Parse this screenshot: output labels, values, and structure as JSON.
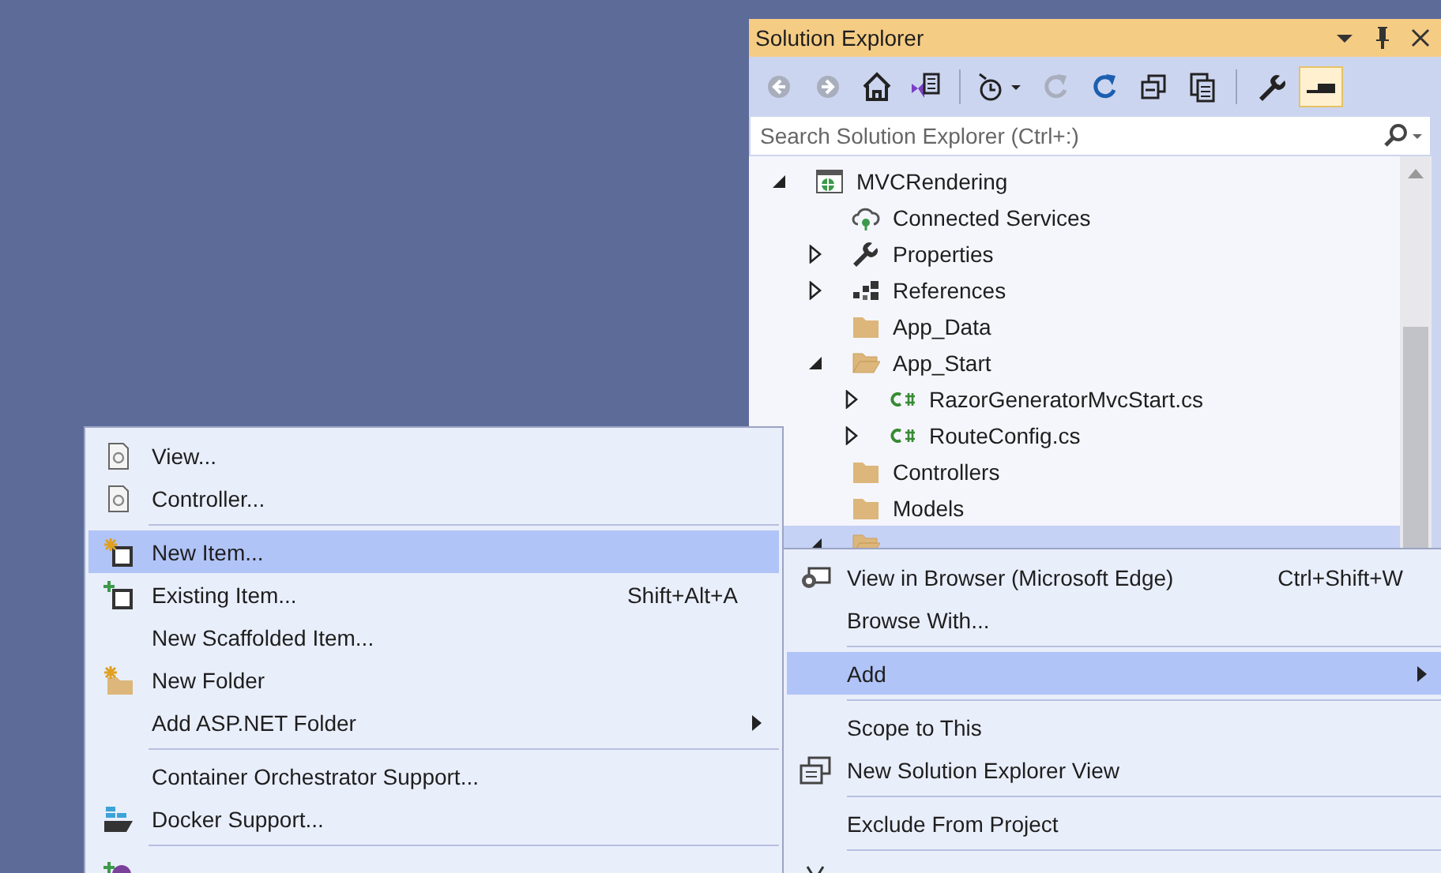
{
  "solution_explorer": {
    "title": "Solution Explorer",
    "toolbar": [
      {
        "kind": "back",
        "disabled": true,
        "on": false
      },
      {
        "kind": "forward",
        "disabled": true,
        "on": false
      },
      {
        "kind": "home",
        "disabled": false,
        "on": false
      },
      {
        "kind": "switch-views",
        "disabled": false,
        "on": false
      },
      {
        "kind": "separator"
      },
      {
        "kind": "pending-changes",
        "disabled": false,
        "on": false
      },
      {
        "kind": "sync",
        "disabled": true,
        "on": false
      },
      {
        "kind": "refresh",
        "disabled": false,
        "on": false
      },
      {
        "kind": "collapse-all",
        "disabled": false,
        "on": false
      },
      {
        "kind": "show-all-files",
        "disabled": false,
        "on": false
      },
      {
        "kind": "separator"
      },
      {
        "kind": "properties",
        "disabled": false,
        "on": false
      },
      {
        "kind": "preview",
        "disabled": false,
        "on": true
      }
    ],
    "search": {
      "placeholder": "Search Solution Explorer (Ctrl+:)"
    },
    "tree": [
      {
        "label": "MVCRendering",
        "kind": "project",
        "expanded": true,
        "selected": false,
        "children": [
          {
            "label": "Connected Services",
            "kind": "cloud",
            "selected": false
          },
          {
            "label": "Properties",
            "kind": "wrench",
            "expanded": false,
            "selected": false
          },
          {
            "label": "References",
            "kind": "references",
            "expanded": false,
            "selected": false
          },
          {
            "label": "App_Data",
            "kind": "folder",
            "selected": false
          },
          {
            "label": "App_Start",
            "kind": "folder",
            "expanded": true,
            "selected": false,
            "children": [
              {
                "label": "RazorGeneratorMvcStart.cs",
                "kind": "csharp",
                "expanded": false,
                "selected": false
              },
              {
                "label": "RouteConfig.cs",
                "kind": "csharp",
                "expanded": false,
                "selected": false
              }
            ]
          },
          {
            "label": "Controllers",
            "kind": "folder",
            "selected": false
          },
          {
            "label": "Models",
            "kind": "folder",
            "selected": false
          },
          {
            "kind": "folder",
            "expanded": true,
            "selected": true
          }
        ]
      }
    ]
  },
  "add_submenu": [
    {
      "kind": "page",
      "label": "View...",
      "selected": false,
      "submenu": false
    },
    {
      "kind": "page",
      "label": "Controller...",
      "selected": false,
      "submenu": false
    },
    {
      "kind": "separator"
    },
    {
      "kind": "new-item",
      "label": "New Item...",
      "selected": true,
      "submenu": false
    },
    {
      "kind": "existing-item",
      "label": "Existing Item...",
      "shortcut": "Shift+Alt+A",
      "selected": false,
      "submenu": false
    },
    {
      "kind": "plain",
      "label": "New Scaffolded Item...",
      "selected": false,
      "submenu": false
    },
    {
      "kind": "new-folder",
      "label": "New Folder",
      "selected": false,
      "submenu": false
    },
    {
      "kind": "plain",
      "label": "Add ASP.NET Folder",
      "selected": false,
      "submenu": true
    },
    {
      "kind": "separator"
    },
    {
      "kind": "plain",
      "label": "Container Orchestrator Support...",
      "selected": false,
      "submenu": false
    },
    {
      "kind": "docker",
      "label": "Docker Support...",
      "selected": false,
      "submenu": false
    },
    {
      "kind": "separator"
    },
    {
      "kind": "insights",
      "selected": false,
      "submenu": false
    }
  ],
  "context_menu": [
    {
      "kind": "browser",
      "label": "View in Browser (Microsoft Edge)",
      "shortcut": "Ctrl+Shift+W",
      "selected": false,
      "submenu": false
    },
    {
      "kind": "plain",
      "label": "Browse With...",
      "selected": false,
      "submenu": false
    },
    {
      "kind": "separator"
    },
    {
      "kind": "plain",
      "label": "Add",
      "selected": true,
      "submenu": true
    },
    {
      "kind": "separator"
    },
    {
      "kind": "plain",
      "label": "Scope to This",
      "selected": false,
      "submenu": false
    },
    {
      "kind": "windows",
      "label": "New Solution Explorer View",
      "selected": false,
      "submenu": false
    },
    {
      "kind": "separator"
    },
    {
      "kind": "plain",
      "label": "Exclude From Project",
      "selected": false,
      "submenu": false
    },
    {
      "kind": "separator"
    },
    {
      "kind": "scissors",
      "selected": false,
      "submenu": false
    }
  ]
}
